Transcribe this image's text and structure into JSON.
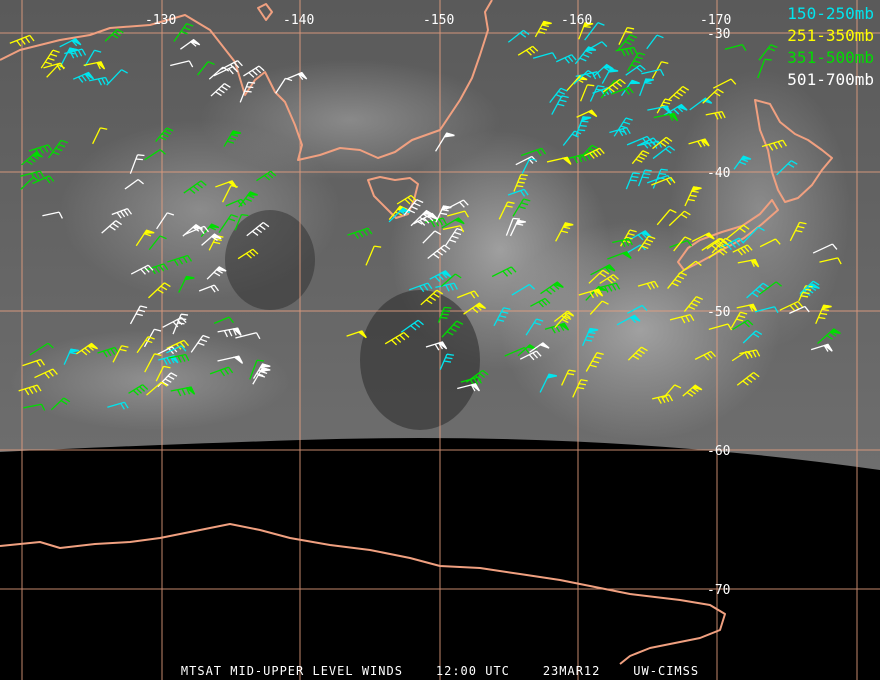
{
  "image": {
    "product": "MTSAT MID-UPPER LEVEL WINDS",
    "time": "12:00 UTC",
    "date": "23MAR12",
    "source": "UW-CIMSS"
  },
  "longitude_labels": [
    "-130",
    "-140",
    "-150",
    "-160",
    "-170"
  ],
  "latitude_labels": [
    "-30",
    "-40",
    "-50",
    "-60",
    "-70"
  ],
  "legend": [
    {
      "label": "150-250mb",
      "color": "#00e5ee"
    },
    {
      "label": "251-350mb",
      "color": "#ffff00"
    },
    {
      "label": "351-500mb",
      "color": "#00dd00"
    },
    {
      "label": "501-700mb",
      "color": "#ffffff"
    }
  ],
  "colors": {
    "grid": "#e8a080",
    "coastline": "#f0a080",
    "background": "#000000"
  }
}
